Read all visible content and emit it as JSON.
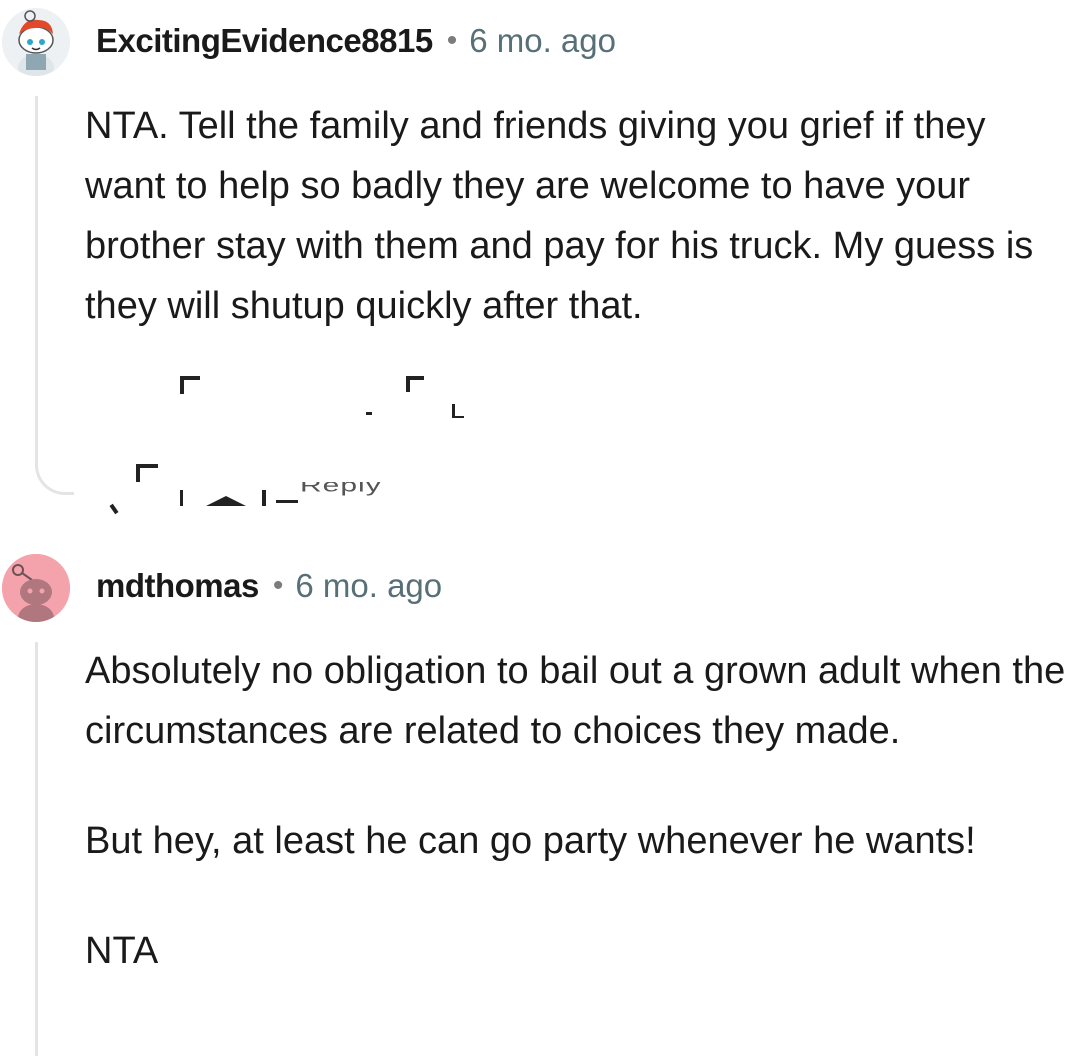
{
  "comments": [
    {
      "username": "ExcitingEvidence8815",
      "separator": "•",
      "time": "6 mo. ago",
      "avatar_icon": "snoo-avatar-red-hair-icon",
      "paragraphs": [
        "NTA. Tell the family and friends giving you grief if they want to help so badly they are welcome to have your brother stay with them and pay for his truck. My guess is they will shutup quickly after that."
      ],
      "reply_label": "Reply"
    },
    {
      "username": "mdthomas",
      "separator": "•",
      "time": "6 mo. ago",
      "avatar_icon": "snoo-avatar-pink-icon",
      "paragraphs": [
        "Absolutely no obligation to bail out a grown adult when the circumstances are related to choices they made.",
        "But hey, at least he can go party whenever he wants!",
        "NTA"
      ]
    }
  ],
  "colors": {
    "username": "#1a1a1b",
    "time": "#576f76",
    "thread_line": "#e4e4e4",
    "avatar2_bg": "#f4a3ac"
  }
}
